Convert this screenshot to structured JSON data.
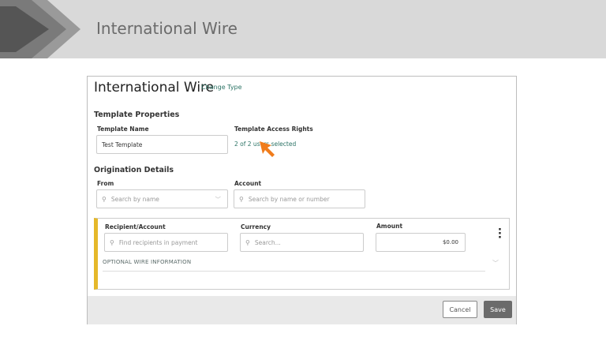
{
  "header": {
    "title": "International Wire"
  },
  "form": {
    "title": "International Wire",
    "change_type": "Change Type",
    "template_properties": {
      "heading": "Template Properties",
      "name_label": "Template Name",
      "name_value": "Test Template",
      "access_label": "Template Access Rights",
      "access_value": "2 of 2 users selected"
    },
    "origination": {
      "heading": "Origination Details",
      "from_label": "From",
      "from_placeholder": "Search by name",
      "account_label": "Account",
      "account_placeholder": "Search by name or number"
    },
    "payment": {
      "recipient_label": "Recipient/Account",
      "recipient_placeholder": "Find recipients in payment",
      "currency_label": "Currency",
      "currency_placeholder": "Search...",
      "amount_label": "Amount",
      "amount_value": "$0.00",
      "optional_label": "OPTIONAL WIRE INFORMATION"
    },
    "footer": {
      "cancel": "Cancel",
      "save": "Save"
    }
  },
  "colors": {
    "accent": "#2d7466",
    "card_border": "#e5b82a",
    "cursor": "#f07c1b",
    "save_bg": "#6b6b6b"
  }
}
